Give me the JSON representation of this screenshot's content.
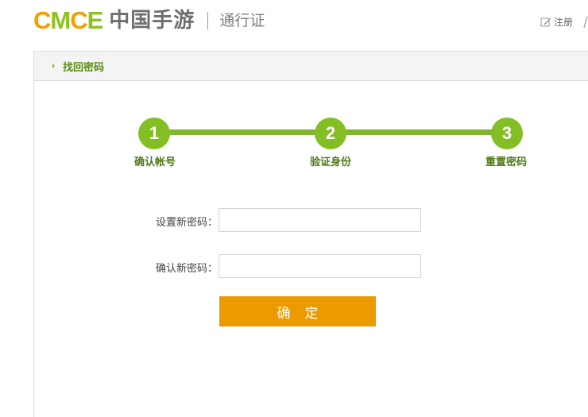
{
  "header": {
    "logo_letters": [
      "C",
      "M",
      "C",
      "E"
    ],
    "logo_colors": [
      "#f0a000",
      "#8dc21f",
      "#f0a000",
      "#8dc21f"
    ],
    "logo_cn": "中国手游",
    "subtitle": "通行证",
    "register_label": "注册"
  },
  "panel": {
    "title": "找回密码"
  },
  "steps": [
    {
      "number": "1",
      "label": "确认帐号"
    },
    {
      "number": "2",
      "label": "验证身份"
    },
    {
      "number": "3",
      "label": "重置密码"
    }
  ],
  "form": {
    "new_password_label": "设置新密码：",
    "new_password_value": "",
    "confirm_password_label": "确认新密码：",
    "confirm_password_value": "",
    "submit_label": "确定"
  },
  "colors": {
    "accent_green": "#84be25",
    "title_green": "#5b8d17",
    "button_orange": "#eb9a00"
  }
}
